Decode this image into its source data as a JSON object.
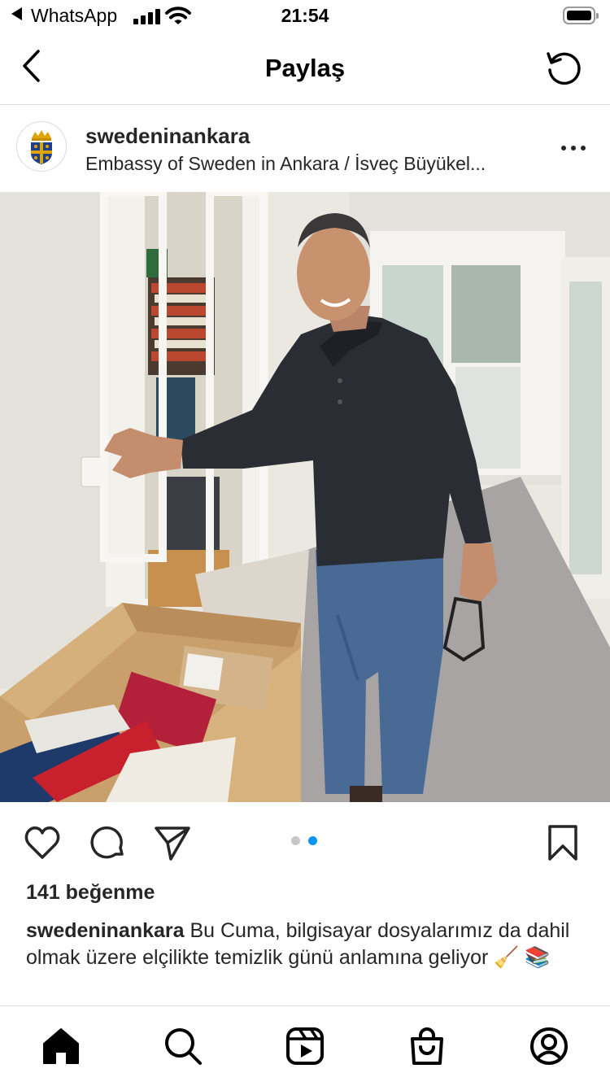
{
  "status_bar": {
    "back_app": "WhatsApp",
    "time": "21:54"
  },
  "header": {
    "title": "Paylaş",
    "back_icon": "chevron-left-icon",
    "refresh_icon": "refresh-icon"
  },
  "post": {
    "username": "swedeninankara",
    "subtitle": "Embassy of Sweden in Ankara / İsveç Büyükel...",
    "likes": "141 beğenme",
    "caption_user": "swedeninankara",
    "caption_text": " Bu Cuma, bilgisayar dosyalarımız da dahil olmak üzere elçilikte temizlik günü anlamına geliyor 🧹 📚",
    "carousel": {
      "total": 2,
      "current": 2
    }
  },
  "colors": {
    "carousel_active": "#0095f6",
    "carousel_inactive": "#c7c7c7",
    "text": "#262626"
  },
  "tab_bar": {
    "tabs": [
      "home-icon",
      "search-icon",
      "reels-icon",
      "shop-icon",
      "profile-icon"
    ]
  }
}
